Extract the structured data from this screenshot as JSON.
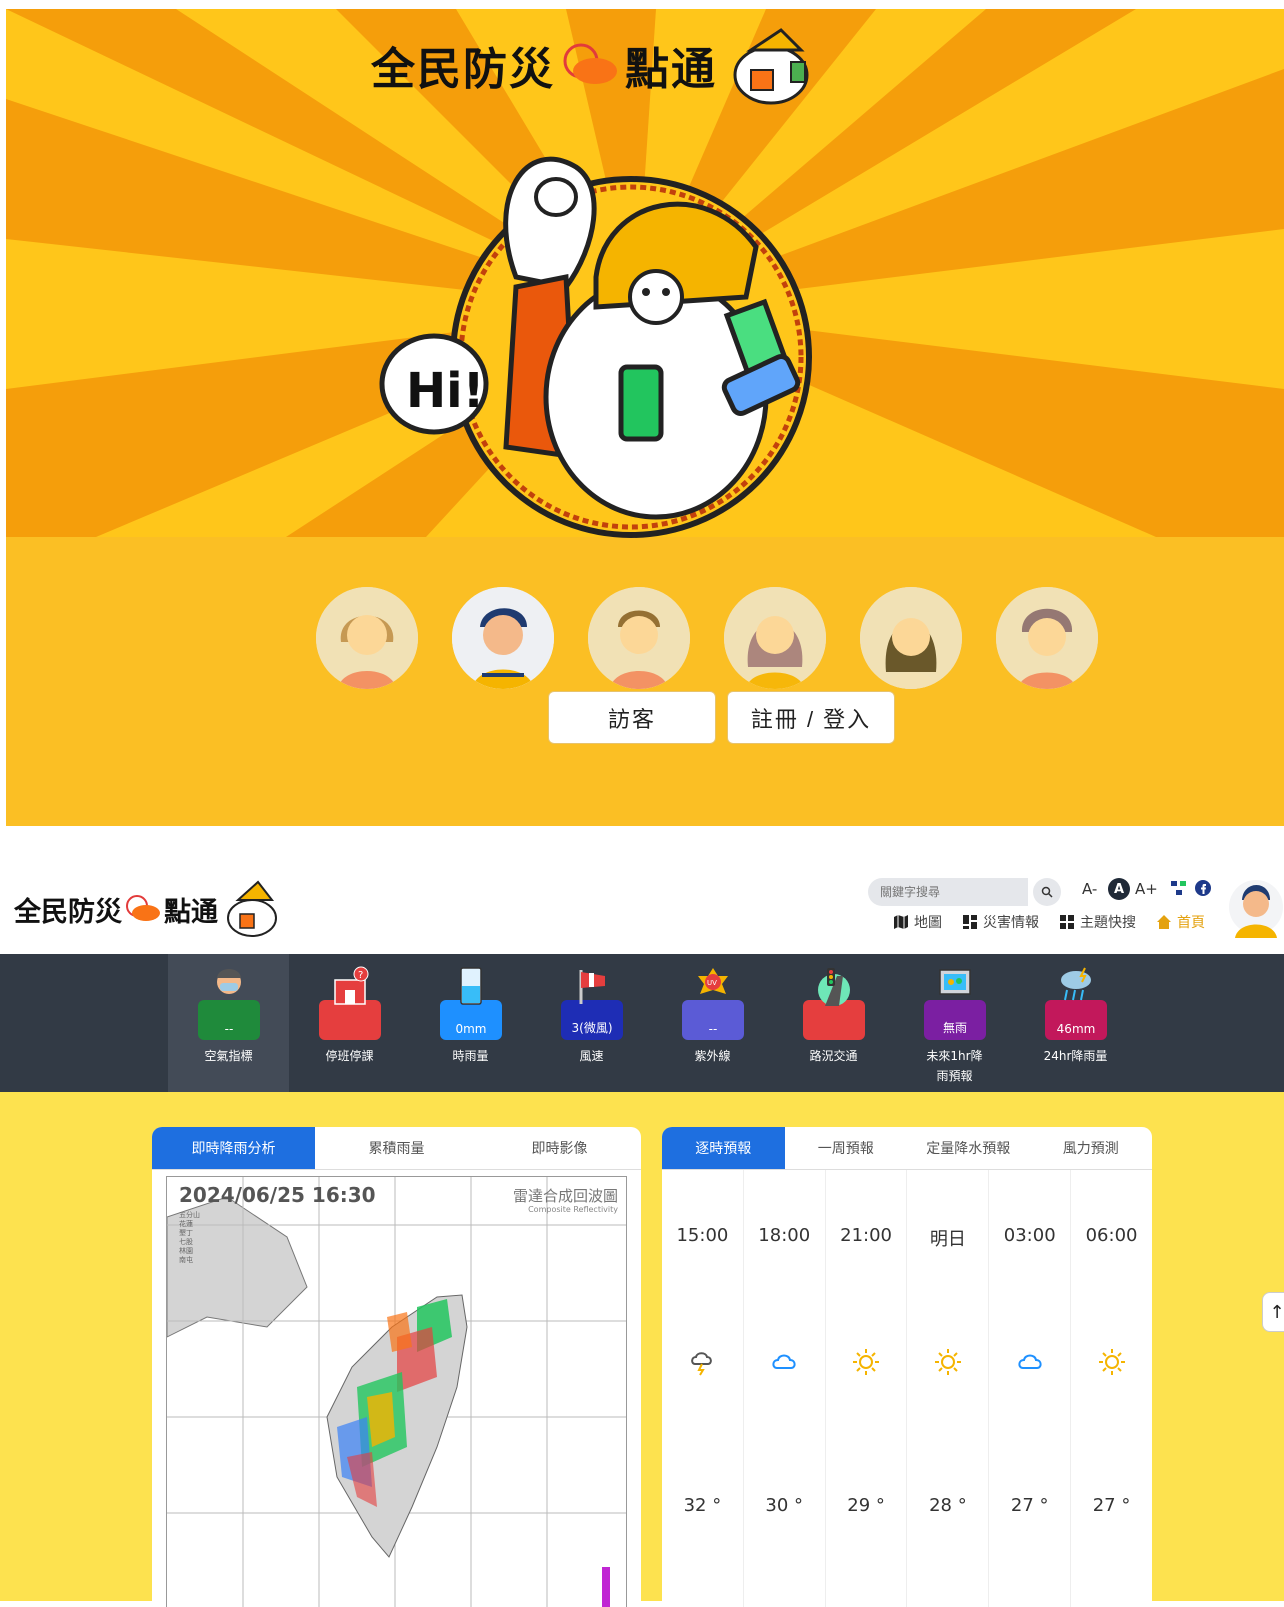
{
  "hero": {
    "logo_text": "全民防災",
    "logo_text_2": "點通",
    "bubble_text": "Hi!",
    "guest_button": "訪客",
    "login_button": "註冊 / 登入"
  },
  "header": {
    "logo_text": "全民防災",
    "logo_text_2": "點通",
    "search_placeholder": "關鍵字搜尋",
    "font_small": "A-",
    "font_normal": "A",
    "font_large": "A+",
    "nav": {
      "map": "地圖",
      "disaster": "災害情報",
      "topics": "主題快搜",
      "home": "首頁"
    }
  },
  "categories": [
    {
      "value": "--",
      "label": "空氣指標",
      "color": "#1f8a3b",
      "icon": "mask-person-icon"
    },
    {
      "value": "",
      "label": "停班停課",
      "color": "#e53e3e",
      "icon": "school-icon"
    },
    {
      "value": "0mm",
      "label": "時雨量",
      "color": "#1e90ff",
      "icon": "rain-gauge-icon"
    },
    {
      "value": "3(微風)",
      "label": "風速",
      "color": "#1e2db5",
      "icon": "windsock-icon"
    },
    {
      "value": "--",
      "label": "紫外線",
      "color": "#5b5bd6",
      "icon": "uv-icon"
    },
    {
      "value": "",
      "label": "路況交通",
      "color": "#e53e3e",
      "icon": "traffic-light-icon"
    },
    {
      "value": "無雨",
      "label": "未來1hr降",
      "label2": "雨預報",
      "color": "#7b1fa2",
      "icon": "radar-screen-icon"
    },
    {
      "value": "46mm",
      "label": "24hr降雨量",
      "color": "#c2185b",
      "icon": "storm-cloud-icon"
    }
  ],
  "left_panel": {
    "tabs": [
      "即時降雨分析",
      "累積雨量",
      "即時影像"
    ],
    "radar_time": "2024/06/25  16:30",
    "radar_title": "雷達合成回波圖",
    "radar_sub": "Composite Reflectivity",
    "legend": [
      "五分山",
      "花蓮",
      "墾丁",
      "七股",
      "林園",
      "南屯"
    ]
  },
  "right_panel": {
    "tabs": [
      "逐時預報",
      "一周預報",
      "定量降水預報",
      "風力預測"
    ],
    "forecast": [
      {
        "time": "15:00",
        "icon": "thunder-cloud-icon",
        "temp": "32 °"
      },
      {
        "time": "18:00",
        "icon": "cloud-icon",
        "temp": "30 °"
      },
      {
        "time": "21:00",
        "icon": "sun-icon",
        "temp": "29 °"
      },
      {
        "time": "明日",
        "icon": "sun-icon",
        "temp": "28 °"
      },
      {
        "time": "03:00",
        "icon": "cloud-icon",
        "temp": "27 °"
      },
      {
        "time": "06:00",
        "icon": "sun-icon",
        "temp": "27 °"
      }
    ]
  },
  "scroll_top": "↑"
}
